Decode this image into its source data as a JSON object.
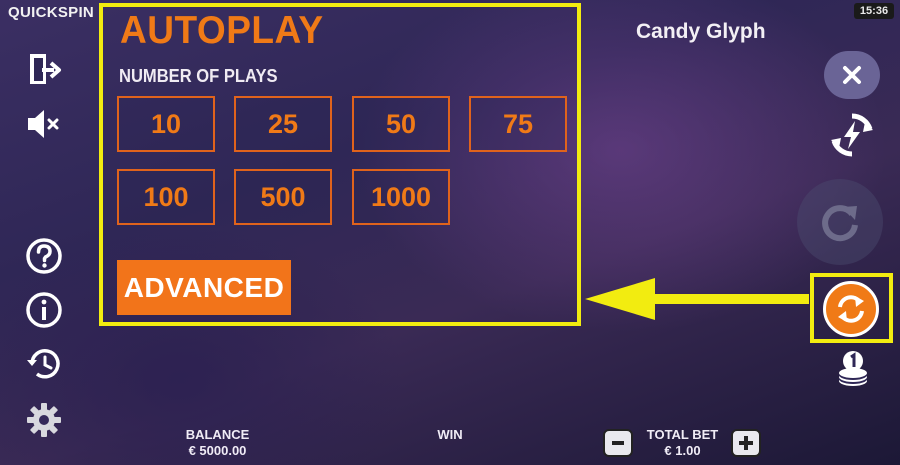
{
  "brand": "QUICKSPIN",
  "clock": "15:36",
  "game_title": "Candy Glyph",
  "autoplay": {
    "title": "AUTOPLAY",
    "plays_label": "NUMBER OF PLAYS",
    "options": [
      "10",
      "25",
      "50",
      "75",
      "100",
      "500",
      "1000"
    ],
    "advanced_label": "ADVANCED"
  },
  "bottom": {
    "balance_label": "BALANCE",
    "balance_value": "€ 5000.00",
    "win_label": "WIN",
    "total_bet_label": "TOTAL BET",
    "total_bet_value": "€ 1.00"
  },
  "icons": {
    "left": [
      "exit-icon",
      "sound-muted-icon",
      "help-icon",
      "info-icon",
      "history-icon",
      "settings-icon"
    ],
    "right": [
      "close-icon",
      "turbo-icon",
      "spin-icon",
      "autoplay-icon",
      "coin-stack-icon"
    ]
  },
  "colors": {
    "accent_orange": "#f07a17",
    "highlight_yellow": "#f2ec10",
    "background": "#2f2756"
  }
}
